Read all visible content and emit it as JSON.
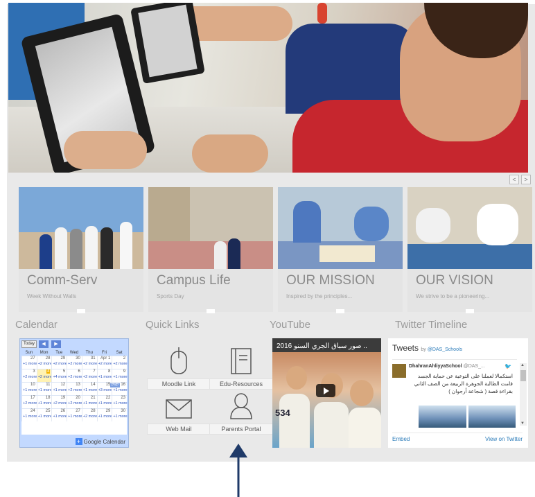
{
  "slider": {
    "prev": "<",
    "next": ">"
  },
  "cards": [
    {
      "title": "Comm-Serv",
      "subtitle": "Week Without Walls"
    },
    {
      "title": "Campus Life",
      "subtitle": "Sports Day"
    },
    {
      "title": "OUR MISSION",
      "subtitle": "Inspired by the principles..."
    },
    {
      "title": "OUR VISION",
      "subtitle": "We strive to be a pioneering..."
    }
  ],
  "sections": {
    "calendar": "Calendar",
    "quick_links": "Quick Links",
    "youtube": "YouTube",
    "twitter": "Twitter Timeline"
  },
  "calendar": {
    "today_label": "Today",
    "prev": "◀",
    "next": "▶",
    "days_of_week": [
      "Sun",
      "Mon",
      "Tue",
      "Wed",
      "Thu",
      "Fri",
      "Sat"
    ],
    "weeks": [
      [
        "27",
        "28",
        "29",
        "30",
        "31",
        "Apr 1",
        "2"
      ],
      [
        "3",
        "4",
        "5",
        "6",
        "7",
        "8",
        "9"
      ],
      [
        "10",
        "11",
        "12",
        "13",
        "14",
        "15",
        "16"
      ],
      [
        "17",
        "18",
        "19",
        "20",
        "21",
        "22",
        "23"
      ],
      [
        "24",
        "25",
        "26",
        "27",
        "28",
        "29",
        "30"
      ]
    ],
    "more_labels": [
      [
        "+1 more",
        "+2 more",
        "+2 more",
        "+2 more",
        "+2 more",
        "+2 more",
        "+2 more"
      ],
      [
        "+2 more",
        "+2 more",
        "+4 more",
        "+2 more",
        "+2 more",
        "+1 more",
        "+1 more"
      ],
      [
        "+1 more",
        "+1 more",
        "+1 more",
        "+2 more",
        "+1 more",
        "+3 more",
        "+1 more"
      ],
      [
        "+2 more",
        "+1 more",
        "+2 more",
        "+2 more",
        "+1 more",
        "+1 more",
        "+1 more"
      ],
      [
        "+1 more",
        "+1 more",
        "+1 more",
        "+1 more",
        "+2 more",
        "+1 more",
        "+1 more"
      ]
    ],
    "today_cell": "4",
    "event_chip": "PYP",
    "footer_plus": "+",
    "footer": "Google Calendar"
  },
  "quick_links": [
    {
      "label": "Moodle Link",
      "icon": "mouse-icon"
    },
    {
      "label": "Edu-Resources",
      "icon": "book-icon"
    },
    {
      "label": "Web Mail",
      "icon": "envelope-icon"
    },
    {
      "label": "Parents Portal",
      "icon": "person-icon"
    }
  ],
  "youtube": {
    "title": "2016 صور سباق الجري السنو ..",
    "bib_number": "534"
  },
  "twitter": {
    "heading": "Tweets",
    "by": "by",
    "account": "@DAS_Schools",
    "tweet_name": "DhahranAhliyyaSchool",
    "tweet_handle": "@DAS_...",
    "tweet_text": "استكمالا لعملنا على التوعية عن حماية الجسد قامت الطالبة الجوهرة الربيعة من الصف الثاني بقراءة قصة ( شجاعة أرجوان )",
    "embed": "Embed",
    "view_on": "View on Twitter"
  },
  "colors": {
    "calendar_bg": "#c3d9ff",
    "annotation_arrow": "#1f3a68",
    "twitter_link": "#2b7bb9"
  }
}
